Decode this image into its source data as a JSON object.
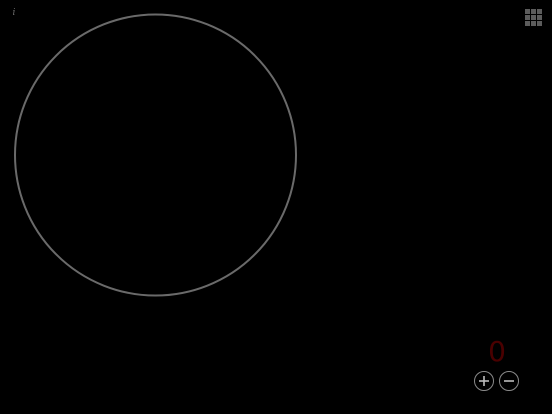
{
  "counter": {
    "value": "0",
    "color": "#4a0000"
  },
  "icons": {
    "top_left": "info-icon",
    "top_right": "grid-menu-icon",
    "increment": "plus-icon",
    "decrement": "minus-icon"
  },
  "colors": {
    "background": "#000000",
    "circle_stroke": "#6a6a6a",
    "controls": "#8a8a8a"
  },
  "info_glyph": "i"
}
